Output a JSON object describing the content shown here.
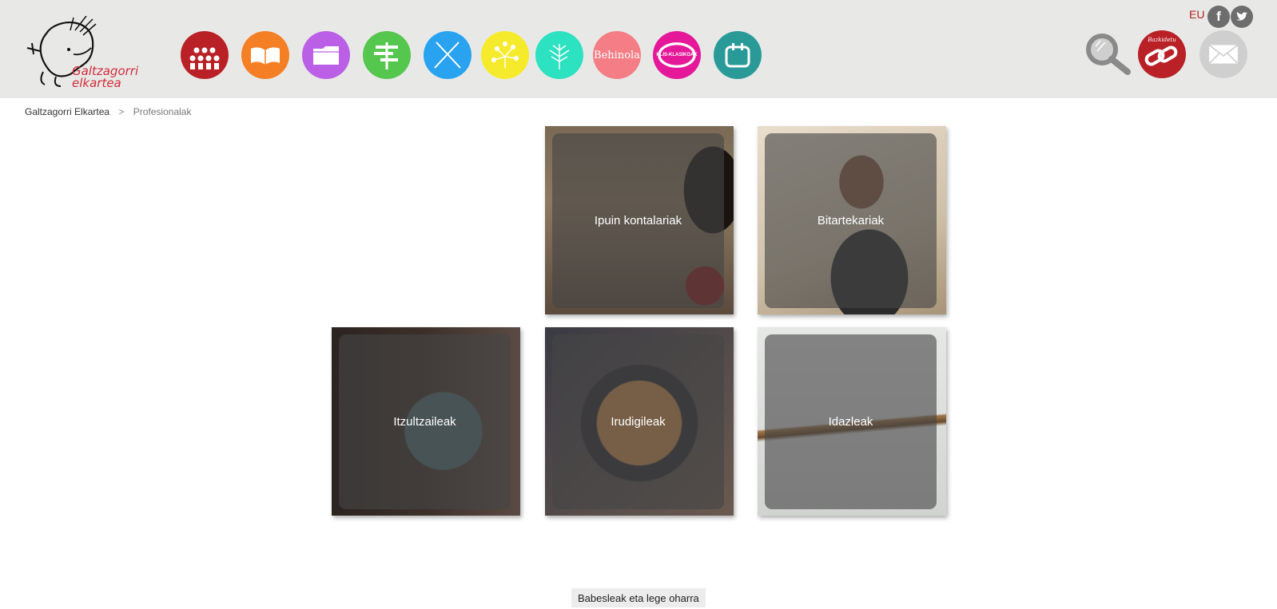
{
  "header": {
    "logo": {
      "line1": "Galtzagorri",
      "line2": "elkartea"
    },
    "nav": [
      {
        "name": "nav-bazkideak",
        "color": "#b92127",
        "icon": "people-dots-icon"
      },
      {
        "name": "nav-liburuak",
        "color": "#f57f24",
        "icon": "open-book-icon"
      },
      {
        "name": "nav-karpetak",
        "color": "#bb5fe6",
        "icon": "folder-icon"
      },
      {
        "name": "nav-seinaleak",
        "color": "#55c64e",
        "icon": "signpost-icon"
      },
      {
        "name": "nav-tresnak",
        "color": "#29a3f0",
        "icon": "crossed-pencils-icon"
      },
      {
        "name": "nav-sarea",
        "color": "#f6ea2c",
        "icon": "network-icon"
      },
      {
        "name": "nav-zuhaitza",
        "color": "#2ce2c1",
        "icon": "tree-icon"
      },
      {
        "name": "nav-behinola",
        "color": "#f57e86",
        "label": "Behinola"
      },
      {
        "name": "nav-klis-klasikoak",
        "color": "#e5189a",
        "label": "KLIS-KLASIKOAK"
      },
      {
        "name": "nav-agenda",
        "color": "#2a9a98",
        "icon": "calendar-icon"
      }
    ],
    "language": "EU",
    "social": [
      {
        "name": "facebook-icon",
        "glyph": "f"
      },
      {
        "name": "twitter-icon",
        "glyph": "t"
      }
    ],
    "bazkidetu_label": "Bazkidetu"
  },
  "breadcrumb": {
    "home": "Galtzagorri Elkartea",
    "separator": ">",
    "current": "Profesionalak"
  },
  "tiles": [
    {
      "label": "Ipuin kontalariak"
    },
    {
      "label": "Bitartekariak"
    },
    {
      "label": "Itzultzaileak"
    },
    {
      "label": "Irudigileak"
    },
    {
      "label": "Idazleak"
    }
  ],
  "footer": {
    "link": "Babesleak eta lege oharra"
  }
}
